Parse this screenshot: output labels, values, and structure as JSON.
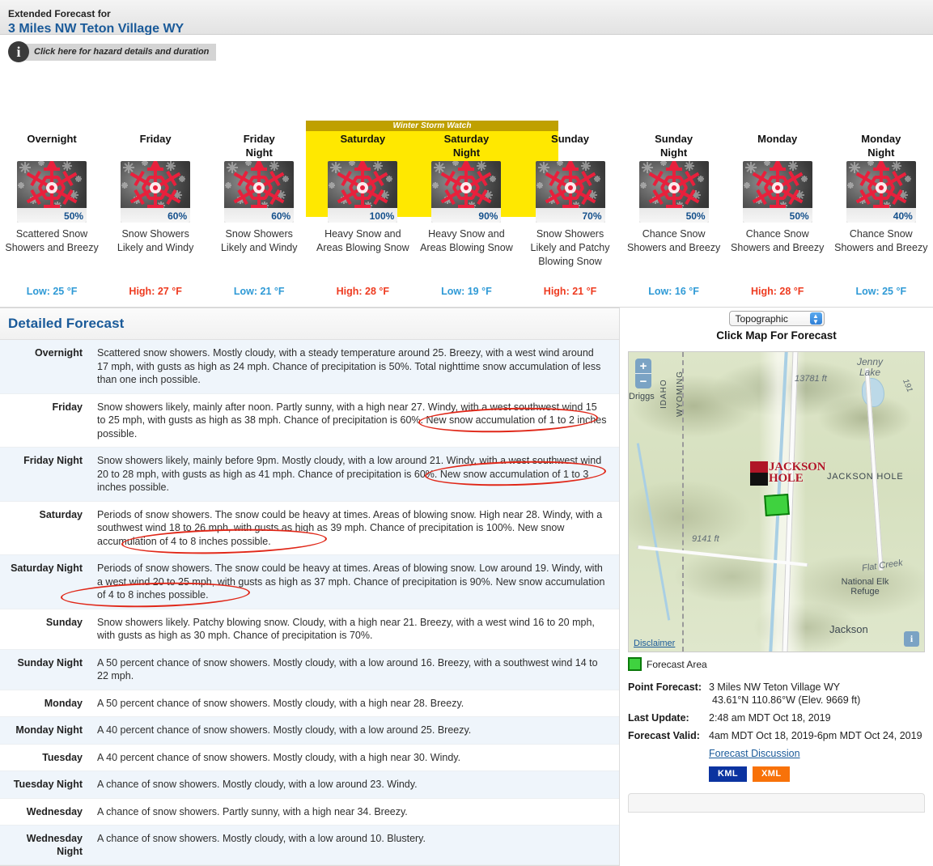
{
  "header": {
    "eyebrow": "Extended Forecast for",
    "location": "3 Miles NW Teton Village WY"
  },
  "hazard": {
    "icon": "info-icon",
    "text": "Click here for hazard details and duration"
  },
  "storm_watch": {
    "label": "Winter Storm Watch"
  },
  "cards": [
    {
      "day_line1": "Overnight",
      "day_line2": "",
      "icon": "snowflake-icon",
      "pop": "50%",
      "desc": "Scattered Snow Showers and Breezy",
      "temp_type": "Low",
      "temp": "Low: 25 °F",
      "in_watch": false
    },
    {
      "day_line1": "Friday",
      "day_line2": "",
      "icon": "snowflake-icon",
      "pop": "60%",
      "desc": "Snow Showers Likely and Windy",
      "temp_type": "High",
      "temp": "High: 27 °F",
      "in_watch": false
    },
    {
      "day_line1": "Friday",
      "day_line2": "Night",
      "icon": "snowflake-icon",
      "pop": "60%",
      "desc": "Snow Showers Likely and Windy",
      "temp_type": "Low",
      "temp": "Low: 21 °F",
      "in_watch": false
    },
    {
      "day_line1": "Saturday",
      "day_line2": "",
      "icon": "snowflake-icon",
      "pop": "100%",
      "desc": "Heavy Snow and Areas Blowing Snow",
      "temp_type": "High",
      "temp": "High: 28 °F",
      "in_watch": true
    },
    {
      "day_line1": "Saturday",
      "day_line2": "Night",
      "icon": "snowflake-icon",
      "pop": "90%",
      "desc": "Heavy Snow and Areas Blowing Snow",
      "temp_type": "Low",
      "temp": "Low: 19 °F",
      "in_watch": true
    },
    {
      "day_line1": "Sunday",
      "day_line2": "",
      "icon": "snowflake-icon",
      "pop": "70%",
      "desc": "Snow Showers Likely and Patchy Blowing Snow",
      "temp_type": "High",
      "temp": "High: 21 °F",
      "in_watch": true
    },
    {
      "day_line1": "Sunday",
      "day_line2": "Night",
      "icon": "snowflake-icon",
      "pop": "50%",
      "desc": "Chance Snow Showers and Breezy",
      "temp_type": "Low",
      "temp": "Low: 16 °F",
      "in_watch": false
    },
    {
      "day_line1": "Monday",
      "day_line2": "",
      "icon": "snowflake-icon",
      "pop": "50%",
      "desc": "Chance Snow Showers and Breezy",
      "temp_type": "High",
      "temp": "High: 28 °F",
      "in_watch": false
    },
    {
      "day_line1": "Monday",
      "day_line2": "Night",
      "icon": "snowflake-icon",
      "pop": "40%",
      "desc": "Chance Snow Showers and Breezy",
      "temp_type": "Low",
      "temp": "Low: 25 °F",
      "in_watch": false
    }
  ],
  "detailed": {
    "title": "Detailed Forecast",
    "rows": [
      {
        "name": "Overnight",
        "text": "Scattered snow showers. Mostly cloudy, with a steady temperature around 25. Breezy, with a west wind around 17 mph, with gusts as high as 24 mph. Chance of precipitation is 50%. Total nighttime snow accumulation of less than one inch possible."
      },
      {
        "name": "Friday",
        "text": "Snow showers likely, mainly after noon. Partly sunny, with a high near 27. Windy, with a west southwest wind 15 to 25 mph, with gusts as high as 38 mph. Chance of precipitation is 60%. New snow accumulation of 1 to 2 inches possible."
      },
      {
        "name": "Friday Night",
        "text": "Snow showers likely, mainly before 9pm. Mostly cloudy, with a low around 21. Windy, with a west southwest wind 20 to 28 mph, with gusts as high as 41 mph. Chance of precipitation is 60%. New snow accumulation of 1 to 3 inches possible."
      },
      {
        "name": "Saturday",
        "text": "Periods of snow showers. The snow could be heavy at times. Areas of blowing snow. High near 28. Windy, with a southwest wind 18 to 26 mph, with gusts as high as 39 mph. Chance of precipitation is 100%. New snow accumulation of 4 to 8 inches possible."
      },
      {
        "name": "Saturday Night",
        "text": "Periods of snow showers. The snow could be heavy at times. Areas of blowing snow. Low around 19. Windy, with a west wind 20 to 25 mph, with gusts as high as 37 mph. Chance of precipitation is 90%. New snow accumulation of 4 to 8 inches possible."
      },
      {
        "name": "Sunday",
        "text": "Snow showers likely. Patchy blowing snow. Cloudy, with a high near 21. Breezy, with a west wind 16 to 20 mph, with gusts as high as 30 mph. Chance of precipitation is 70%."
      },
      {
        "name": "Sunday Night",
        "text": "A 50 percent chance of snow showers. Mostly cloudy, with a low around 16. Breezy, with a southwest wind 14 to 22 mph."
      },
      {
        "name": "Monday",
        "text": "A 50 percent chance of snow showers. Mostly cloudy, with a high near 28. Breezy."
      },
      {
        "name": "Monday Night",
        "text": "A 40 percent chance of snow showers. Mostly cloudy, with a low around 25. Breezy."
      },
      {
        "name": "Tuesday",
        "text": "A 40 percent chance of snow showers. Mostly cloudy, with a high near 30. Windy."
      },
      {
        "name": "Tuesday Night",
        "text": "A chance of snow showers. Mostly cloudy, with a low around 23. Windy."
      },
      {
        "name": "Wednesday",
        "text": "A chance of snow showers. Partly sunny, with a high near 34. Breezy."
      },
      {
        "name": "Wednesday Night",
        "text": "A chance of snow showers. Mostly cloudy, with a low around 10. Blustery."
      }
    ]
  },
  "map_panel": {
    "select_value": "Topographic",
    "click_map_label": "Click Map For Forecast",
    "zoom_in": "+",
    "zoom_out": "−",
    "info_button": "i",
    "disclaimer": "Disclaimer",
    "labels": [
      "IDAHO",
      "WYOMING",
      "Driggs",
      "Jenny Lake",
      "13781 ft",
      "191",
      "JACKSON HOLE",
      "Flat Creek",
      "National Elk Refuge",
      "9141 ft",
      "Jackson"
    ],
    "logo_text_1": "JACKSON",
    "logo_text_2": "HOLE",
    "legend_label": "Forecast Area"
  },
  "point_forecast": {
    "point_label": "Point Forecast:",
    "point_value": "3 Miles NW Teton Village WY",
    "point_coords": "43.61°N 110.86°W (Elev. 9669 ft)",
    "last_update_label": "Last Update",
    "last_update_value": "2:48 am MDT Oct 18, 2019",
    "forecast_valid_label": "Forecast Valid",
    "forecast_valid_value": "4am MDT Oct 18, 2019-6pm MDT Oct 24, 2019",
    "discussion_link": "Forecast Discussion",
    "kml_label": "KML",
    "xml_label": "XML"
  },
  "colors": {
    "link_blue": "#1a5a99",
    "low_temp": "#2f9ad6",
    "high_temp": "#ee3b20",
    "watch_yellow": "#ffe800",
    "watch_header": "#bfa000",
    "annotation_red": "#e02718"
  }
}
